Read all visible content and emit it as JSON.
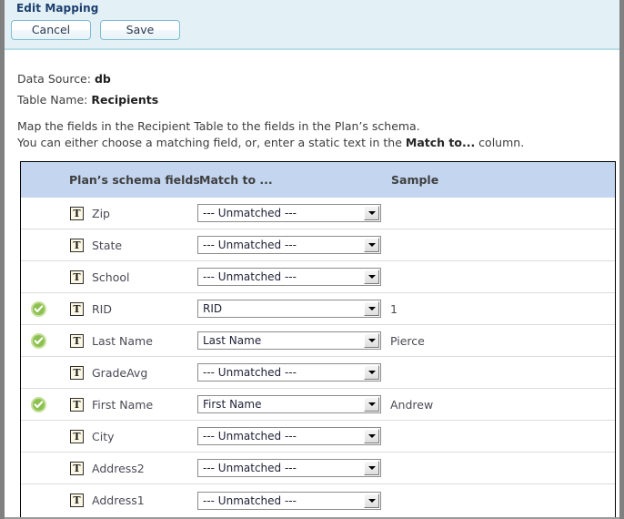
{
  "window": {
    "title": "Edit Mapping"
  },
  "toolbar": {
    "cancel_label": "Cancel",
    "save_label": "Save"
  },
  "meta": {
    "data_source_label": "Data Source:",
    "data_source_value": "db",
    "table_name_label": "Table Name:",
    "table_name_value": "Recipients"
  },
  "instructions": {
    "line1": "Map the fields in the Recipient Table to the fields in the Plan’s schema.",
    "line2_prefix": "You can either choose a matching  field, or, enter a static text in the ",
    "line2_bold": "Match to...",
    "line2_suffix": " column."
  },
  "table": {
    "columns": {
      "schema": "Plan’s schema fields",
      "match": "Match to ...",
      "sample": "Sample"
    },
    "unmatched_option": "--- Unmatched ---",
    "type_icon_glyph": "T",
    "rows": [
      {
        "field": "Zip",
        "match": "--- Unmatched ---",
        "sample": "",
        "matched": false
      },
      {
        "field": "State",
        "match": "--- Unmatched ---",
        "sample": "",
        "matched": false
      },
      {
        "field": "School",
        "match": "--- Unmatched ---",
        "sample": "",
        "matched": false
      },
      {
        "field": "RID",
        "match": "RID",
        "sample": "1",
        "matched": true
      },
      {
        "field": "Last Name",
        "match": "Last Name",
        "sample": "Pierce",
        "matched": true
      },
      {
        "field": "GradeAvg",
        "match": "--- Unmatched ---",
        "sample": "",
        "matched": false
      },
      {
        "field": "First Name",
        "match": "First Name",
        "sample": "Andrew",
        "matched": true
      },
      {
        "field": "City",
        "match": "--- Unmatched ---",
        "sample": "",
        "matched": false
      },
      {
        "field": "Address2",
        "match": "--- Unmatched ---",
        "sample": "",
        "matched": false
      },
      {
        "field": "Address1",
        "match": "--- Unmatched ---",
        "sample": "",
        "matched": false
      }
    ]
  },
  "colors": {
    "titlebar_bg": "#e3f1f7",
    "title_text": "#1c3f6e",
    "button_border": "#7fbcd4",
    "table_header_bg": "#c3d5ef",
    "check_green": "#8cc152",
    "type_icon_bg": "#fcf8e4",
    "window_chrome": "#808080"
  }
}
